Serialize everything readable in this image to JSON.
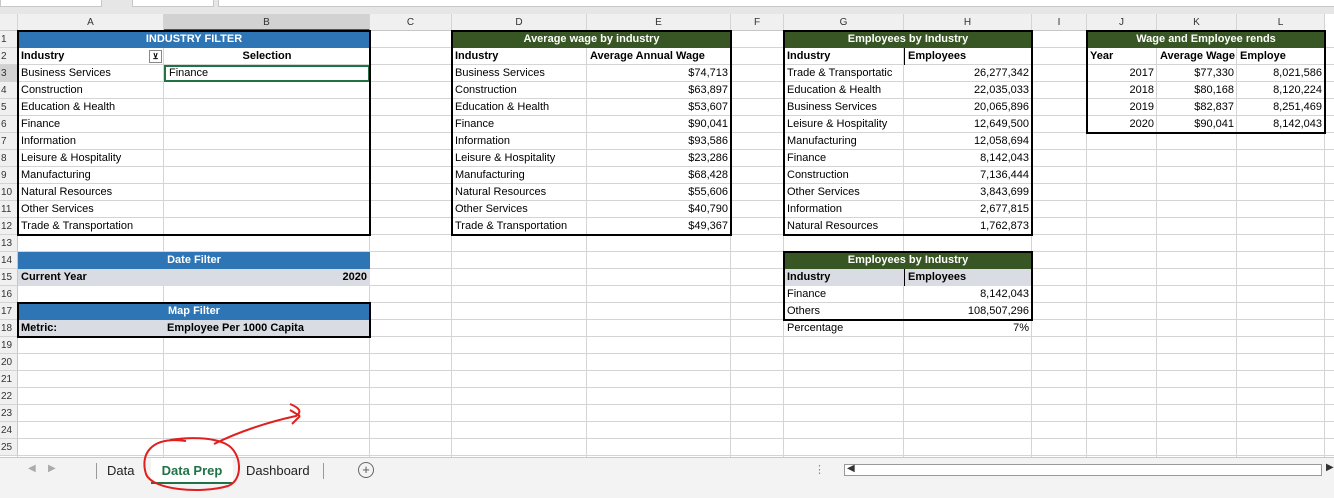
{
  "columns": [
    {
      "letter": "A",
      "w": 146
    },
    {
      "letter": "B",
      "w": 206
    },
    {
      "letter": "C",
      "w": 82
    },
    {
      "letter": "D",
      "w": 135
    },
    {
      "letter": "E",
      "w": 144
    },
    {
      "letter": "F",
      "w": 53
    },
    {
      "letter": "G",
      "w": 120
    },
    {
      "letter": "H",
      "w": 128
    },
    {
      "letter": "I",
      "w": 55
    },
    {
      "letter": "J",
      "w": 70
    },
    {
      "letter": "K",
      "w": 80
    },
    {
      "letter": "L",
      "w": 88
    }
  ],
  "rows": [
    "1",
    "2",
    "3",
    "4",
    "5",
    "6",
    "7",
    "8",
    "9",
    "10",
    "11",
    "12",
    "13",
    "14",
    "15",
    "16",
    "17",
    "18",
    "19",
    "20",
    "21",
    "22",
    "23",
    "24",
    "25"
  ],
  "industry_filter": {
    "title": "INDUSTRY FILTER",
    "col_industry": "Industry",
    "col_selection": "Selection",
    "selection": "Finance",
    "items": [
      "Business Services",
      "Construction",
      "Education & Health",
      "Finance",
      "Information",
      "Leisure & Hospitality",
      "Manufacturing",
      "Natural Resources",
      "Other Services",
      "Trade & Transportation"
    ]
  },
  "date_filter": {
    "title": "Date Filter",
    "label": "Current Year",
    "value": "2020"
  },
  "map_filter": {
    "title": "Map Filter",
    "label": "Metric:",
    "value": "Employee Per 1000 Capita"
  },
  "avg_wage": {
    "title": "Average wage by industry",
    "col1": "Industry",
    "col2": "Average Annual Wage",
    "rows": [
      {
        "industry": "Business Services",
        "wage": "$74,713"
      },
      {
        "industry": "Construction",
        "wage": "$63,897"
      },
      {
        "industry": "Education & Health",
        "wage": "$53,607"
      },
      {
        "industry": "Finance",
        "wage": "$90,041"
      },
      {
        "industry": "Information",
        "wage": "$93,586"
      },
      {
        "industry": "Leisure & Hospitality",
        "wage": "$23,286"
      },
      {
        "industry": "Manufacturing",
        "wage": "$68,428"
      },
      {
        "industry": "Natural Resources",
        "wage": "$55,606"
      },
      {
        "industry": "Other Services",
        "wage": "$40,790"
      },
      {
        "industry": "Trade & Transportation",
        "wage": "$49,367"
      }
    ]
  },
  "emp_by_industry": {
    "title": "Employees by Industry",
    "col1": "Industry",
    "col2": "Employees",
    "rows": [
      {
        "industry": "Trade & Transportatic",
        "employees": "26,277,342"
      },
      {
        "industry": "Education & Health",
        "employees": "22,035,033"
      },
      {
        "industry": "Business Services",
        "employees": "20,065,896"
      },
      {
        "industry": "Leisure & Hospitality",
        "employees": "12,649,500"
      },
      {
        "industry": "Manufacturing",
        "employees": "12,058,694"
      },
      {
        "industry": "Finance",
        "employees": "8,142,043"
      },
      {
        "industry": "Construction",
        "employees": "7,136,444"
      },
      {
        "industry": "Other Services",
        "employees": "3,843,699"
      },
      {
        "industry": "Information",
        "employees": "2,677,815"
      },
      {
        "industry": "Natural Resources",
        "employees": "1,762,873"
      }
    ]
  },
  "emp_share": {
    "title": "Employees by Industry",
    "col1": "Industry",
    "col2": "Employees",
    "rows": [
      {
        "industry": "Finance",
        "employees": "8,142,043"
      },
      {
        "industry": "Others",
        "employees": "108,507,296"
      }
    ],
    "pct_label": "Percentage",
    "pct_value": "7%"
  },
  "trends": {
    "title": "Wage and Employee rends",
    "col1": "Year",
    "col2": "Average Wage",
    "col3": "Employe",
    "rows": [
      {
        "year": "2017",
        "wage": "$77,330",
        "employees": "8,021,586"
      },
      {
        "year": "2018",
        "wage": "$80,168",
        "employees": "8,120,224"
      },
      {
        "year": "2019",
        "wage": "$82,837",
        "employees": "8,251,469"
      },
      {
        "year": "2020",
        "wage": "$90,041",
        "employees": "8,142,043"
      }
    ]
  },
  "tabs": {
    "t1": "Data",
    "t2": "Data Prep",
    "t3": "Dashboard",
    "add": "+"
  },
  "colors": {
    "blue": "#2e75b6",
    "green": "#375623",
    "grey": "#d9dde3",
    "annotation": "#e02020",
    "active_tab": "#217346"
  }
}
